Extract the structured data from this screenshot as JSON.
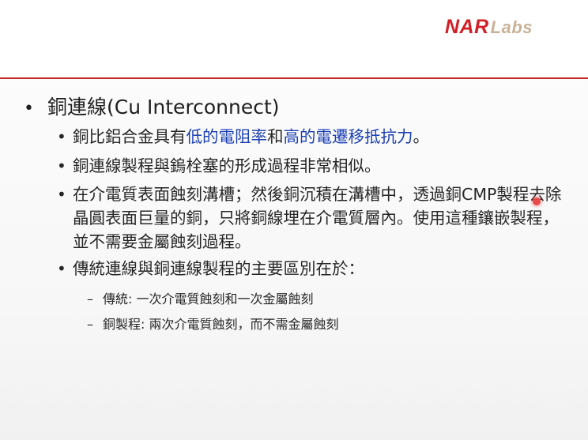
{
  "logo": {
    "part1": "NAR",
    "part2": "Labs"
  },
  "heading": {
    "bullet": "•",
    "text": "銅連線(Cu Interconnect)"
  },
  "bullets": [
    {
      "bullet": "•",
      "segments": [
        "銅比鋁合金具有",
        "低的電阻率",
        "和",
        "高的電遷移抵抗力",
        "。"
      ]
    },
    {
      "bullet": "•",
      "text": "銅連線製程與鎢栓塞的形成過程非常相似。"
    },
    {
      "bullet": "•",
      "text": "在介電質表面蝕刻溝槽；然後銅沉積在溝槽中，透過銅CMP製程去除晶圓表面巨量的銅，只將銅線埋在介電質層內。使用這種鑲嵌製程，並不需要金屬蝕刻過程。"
    },
    {
      "bullet": "•",
      "text": "傳統連線與銅連線製程的主要區別在於："
    }
  ],
  "sub_bullets": [
    {
      "dash": "–",
      "text": "傳統: 一次介電質蝕刻和一次金屬蝕刻"
    },
    {
      "dash": "–",
      "text": "銅製程: 兩次介電質蝕刻，而不需金屬蝕刻"
    }
  ],
  "colors": {
    "accent_red": "#c42a2a",
    "highlight_blue": "#1b3fb5",
    "logo_red": "#d31f26",
    "logo_tan": "#c9b299"
  }
}
